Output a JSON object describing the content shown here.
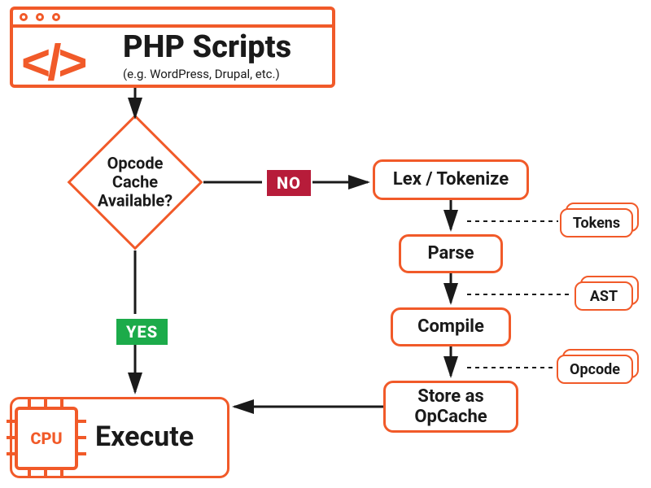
{
  "header": {
    "title": "PHP Scripts",
    "subtitle": "(e.g. WordPress, Drupal, etc.)",
    "glyph": "</>"
  },
  "decision": {
    "label": "Opcode\nCache\nAvailable?",
    "no_label": "NO",
    "yes_label": "YES"
  },
  "pipeline": {
    "lex": "Lex / Tokenize",
    "parse": "Parse",
    "compile": "Compile",
    "store": "Store as\nOpCache"
  },
  "artifacts": {
    "tokens": "Tokens",
    "ast": "AST",
    "opcode": "Opcode"
  },
  "execute": {
    "label": "Execute",
    "cpu": "CPU"
  }
}
